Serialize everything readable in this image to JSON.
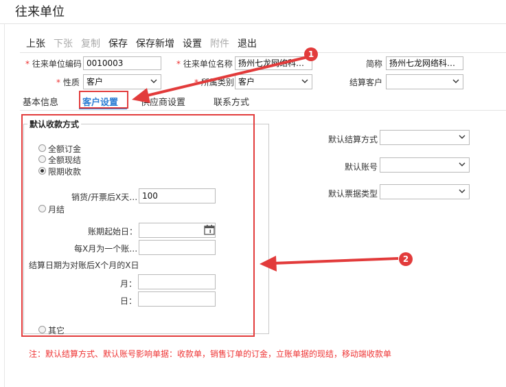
{
  "window": {
    "title": "往来单位"
  },
  "toolbar": {
    "prev": "上张",
    "next": "下张",
    "copy": "复制",
    "save": "保存",
    "save_new": "保存新增",
    "settings": "设置",
    "attachment": "附件",
    "exit": "退出"
  },
  "form": {
    "code_label": "往来单位编码",
    "code_value": "0010003",
    "name_label": "往来单位名称",
    "name_value": "扬州七龙网络科…",
    "abbr_label": "简称",
    "abbr_value": "扬州七龙网络科…",
    "nature_label": "性质",
    "nature_value": "客户",
    "category_label": "所属类别",
    "category_value": "客户",
    "settle_client_label": "结算客户",
    "settle_client_value": "",
    "required_mark": "*"
  },
  "tabs": [
    "基本信息",
    "客户设置",
    "供应商设置",
    "联系方式"
  ],
  "collection": {
    "legend": "默认收款方式",
    "options": {
      "full_order": "全额订金",
      "full_cash": "全额现结",
      "term": "限期收款",
      "monthly": "月结",
      "other": "其它"
    },
    "selected": "term",
    "days_label": "销货/开票后X天…",
    "days_value": "100",
    "period_start_label": "账期起始日：",
    "period_start_value": "",
    "months_per_period_label": "每X月为一个账…",
    "months_per_period_value": "",
    "settle_date_label": "结算日期为对账后X个月的X日",
    "month_label": "月：",
    "month_value": "",
    "day_label": "日：",
    "day_value": ""
  },
  "right_fields": {
    "settle_method_label": "默认结算方式",
    "settle_method_value": "",
    "account_label": "默认账号",
    "account_value": "",
    "bill_type_label": "默认票据类型",
    "bill_type_value": ""
  },
  "note": "注：默认结算方式、默认账号影响单据：收款单，销售订单的订金，立账单据的现结，移动端收款单",
  "annotations": {
    "badge1": "1",
    "badge2": "2",
    "color": "#e23b3b"
  }
}
